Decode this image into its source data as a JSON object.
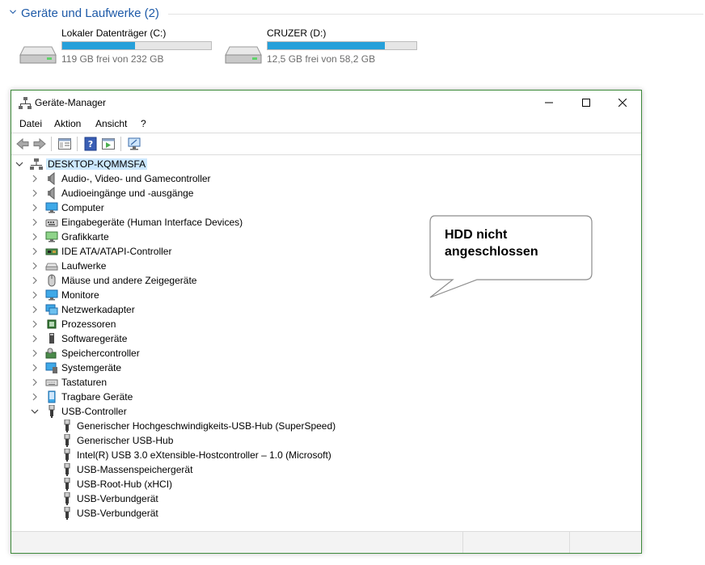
{
  "explorer": {
    "section_title": "Geräte und Laufwerke (2)",
    "drives": [
      {
        "name": "Lokaler Datenträger (C:)",
        "free_text": "119 GB frei von 232 GB",
        "used_fraction": 0.49,
        "bar_color": "#26a0da"
      },
      {
        "name": "CRUZER (D:)",
        "free_text": "12,5 GB frei von 58,2 GB",
        "used_fraction": 0.79,
        "bar_color": "#26a0da"
      }
    ]
  },
  "window": {
    "title": "Geräte-Manager",
    "border_color": "#3d8a3a",
    "menu": [
      "Datei",
      "Aktion",
      "Ansicht",
      "?"
    ],
    "root": "DESKTOP-KQMMSFA",
    "categories": [
      {
        "label": "Audio-, Video- und Gamecontroller",
        "icon": "speaker-icon"
      },
      {
        "label": "Audioeingänge und -ausgänge",
        "icon": "speaker-icon"
      },
      {
        "label": "Computer",
        "icon": "computer-icon"
      },
      {
        "label": "Eingabegeräte (Human Interface Devices)",
        "icon": "hid-icon"
      },
      {
        "label": "Grafikkarte",
        "icon": "display-adapter-icon"
      },
      {
        "label": "IDE ATA/ATAPI-Controller",
        "icon": "ide-controller-icon"
      },
      {
        "label": "Laufwerke",
        "icon": "disk-drive-icon"
      },
      {
        "label": "Mäuse und andere Zeigegeräte",
        "icon": "mouse-icon"
      },
      {
        "label": "Monitore",
        "icon": "monitor-icon"
      },
      {
        "label": "Netzwerkadapter",
        "icon": "network-adapter-icon"
      },
      {
        "label": "Prozessoren",
        "icon": "processor-icon"
      },
      {
        "label": "Softwaregeräte",
        "icon": "software-device-icon"
      },
      {
        "label": "Speichercontroller",
        "icon": "storage-controller-icon"
      },
      {
        "label": "Systemgeräte",
        "icon": "system-device-icon"
      },
      {
        "label": "Tastaturen",
        "icon": "keyboard-icon"
      },
      {
        "label": "Tragbare Geräte",
        "icon": "portable-device-icon"
      },
      {
        "label": "USB-Controller",
        "icon": "usb-icon",
        "expanded": true
      }
    ],
    "usb_children": [
      "Generischer Hochgeschwindigkeits-USB-Hub (SuperSpeed)",
      "Generischer USB-Hub",
      "Intel(R) USB 3.0 eXtensible-Hostcontroller – 1.0 (Microsoft)",
      "USB-Massenspeichergerät",
      "USB-Root-Hub (xHCI)",
      "USB-Verbundgerät",
      "USB-Verbundgerät"
    ]
  },
  "callout": {
    "text": "HDD nicht angeschlossen"
  }
}
